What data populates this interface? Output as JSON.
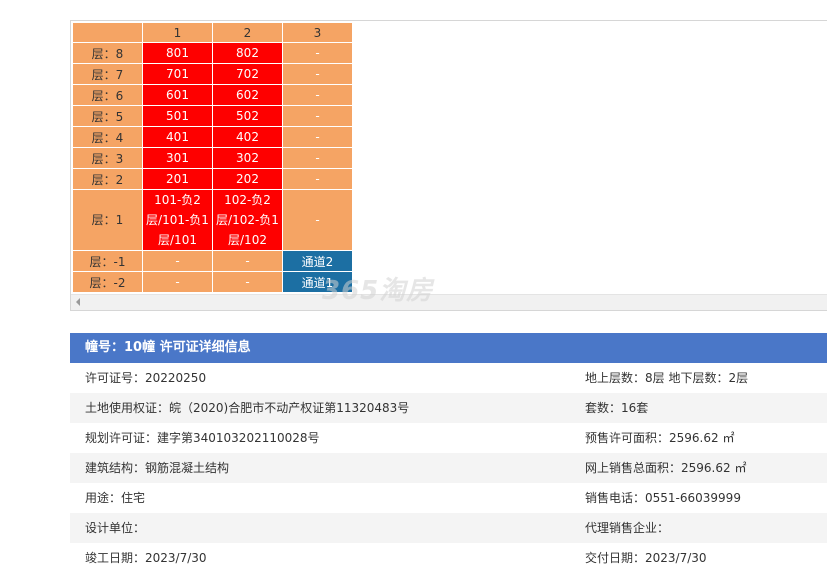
{
  "grid": {
    "columns": [
      "1",
      "2",
      "3"
    ],
    "rows": [
      {
        "label": "层：8",
        "units": [
          "801",
          "802",
          "-"
        ]
      },
      {
        "label": "层：7",
        "units": [
          "701",
          "702",
          "-"
        ]
      },
      {
        "label": "层：6",
        "units": [
          "601",
          "602",
          "-"
        ]
      },
      {
        "label": "层：5",
        "units": [
          "501",
          "502",
          "-"
        ]
      },
      {
        "label": "层：4",
        "units": [
          "401",
          "402",
          "-"
        ]
      },
      {
        "label": "层：3",
        "units": [
          "301",
          "302",
          "-"
        ]
      },
      {
        "label": "层：2",
        "units": [
          "201",
          "202",
          "-"
        ]
      },
      {
        "label": "层：1",
        "units": [
          "101-负2层/101-负1层/101",
          "102-负2层/102-负1层/102",
          "-"
        ]
      },
      {
        "label": "层：-1",
        "units": [
          "-",
          "-",
          "通道2"
        ]
      },
      {
        "label": "层：-2",
        "units": [
          "-",
          "-",
          "通道1"
        ]
      }
    ]
  },
  "watermark": "365淘房",
  "info": {
    "header": "幢号：10幢 许可证详细信息",
    "permit_no": "许可证号：20220250",
    "floors": "地上层数：8层  地下层数：2层",
    "land_cert": "土地使用权证：皖（2020)合肥市不动产权证第11320483号",
    "units": "套数：16套",
    "planning": "规划许可证：建字第340103202110028号",
    "presale_area": "预售许可面积：2596.62 ㎡",
    "structure": "建筑结构：钢筋混凝土结构",
    "online_area": "网上销售总面积：2596.62 ㎡",
    "usage": "用途：住宅",
    "phone": "销售电话：0551-66039999",
    "designer": "设计单位：",
    "agent": "代理销售企业：",
    "completion": "竣工日期：2023/7/30",
    "delivery": "交付日期：2023/7/30"
  }
}
